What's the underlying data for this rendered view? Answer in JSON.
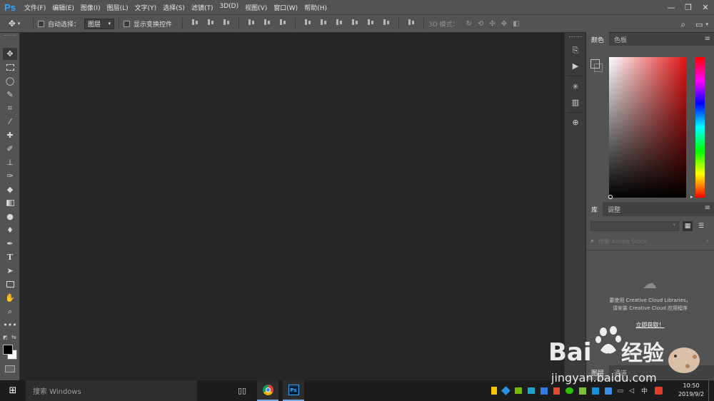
{
  "app": {
    "logo": "Ps"
  },
  "menu": [
    "文件(F)",
    "编辑(E)",
    "图像(I)",
    "图层(L)",
    "文字(Y)",
    "选择(S)",
    "滤镜(T)",
    "3D(D)",
    "视图(V)",
    "窗口(W)",
    "帮助(H)"
  ],
  "window_controls": {
    "minimize": "—",
    "restore": "❐",
    "close": "✕"
  },
  "options_bar": {
    "auto_select_label": "自动选择：",
    "auto_select_value": "图层",
    "show_transform_label": "显示变换控件",
    "mode_3d_label": "3D 模式："
  },
  "panels": {
    "color": {
      "tabs": [
        "颜色",
        "色板"
      ],
      "foreground": "#000000",
      "background": "#ffffff"
    },
    "library": {
      "tabs": [
        "库",
        "调整"
      ],
      "search_placeholder": "搜索 Adobe Stock",
      "message_line1": "要使用 Creative Cloud Libraries，",
      "message_line2": "请安装 Creative Cloud 应用程序",
      "link": "立即获取！"
    },
    "layers_tabs": [
      "图层",
      "通道"
    ]
  },
  "taskbar": {
    "search_placeholder": "搜索 Windows",
    "time": "10:50",
    "date": "2019/9/2",
    "ime": "中"
  },
  "watermark": {
    "logo": "Bai du 经验",
    "url": "jingyan.baidu.com"
  }
}
